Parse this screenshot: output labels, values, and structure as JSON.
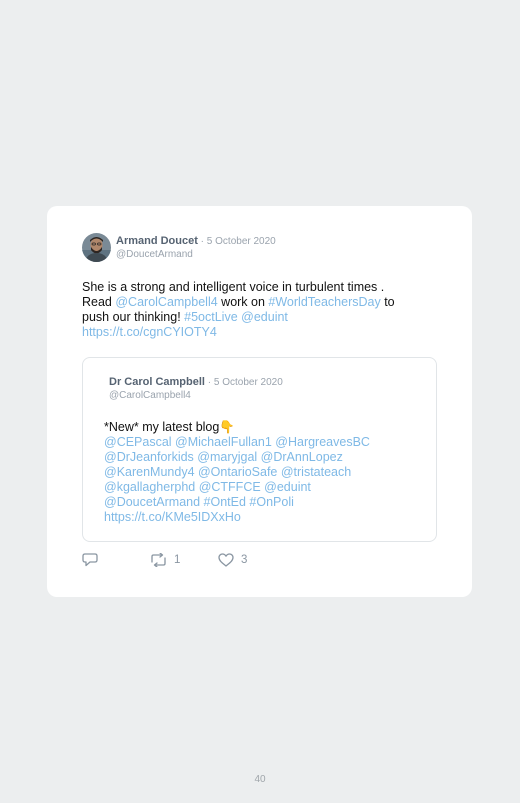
{
  "tweet": {
    "author_name": "Armand Doucet",
    "separator": " · ",
    "date": "5 October 2020",
    "handle": "@DoucetArmand",
    "line1": "She is a strong and intelligent voice in turbulent times .",
    "line2_prefix": "Read ",
    "mention_carol": "@CarolCampbell4",
    "line2_mid": " work on ",
    "hashtag_wtd": "#WorldTeachersDay",
    "line2_suffix": " to",
    "line3_prefix": "push our thinking! ",
    "hashtag_5oct": "#5octLive",
    "mention_eduint": "@eduint",
    "link": "https://t.co/cgnCYIOTY4"
  },
  "quoted_tweet": {
    "author_name": "Dr Carol Campbell",
    "separator": " · ",
    "date": "5 October 2020",
    "handle": "@CarolCampbell4",
    "line1": "*New* my latest blog",
    "emoji": "👇",
    "line2": "@CEPascal @MichaelFullan1 @HargreavesBC",
    "line3": "@DrJeanforkids @maryjgal @DrAnnLopez",
    "line4": "@KarenMundy4 @OntarioSafe @tristateach",
    "line5": "@kgallagherphd @CTFFCE @eduint",
    "line6": "@DoucetArmand #OntEd #OnPoli",
    "link": "https://t.co/KMe5IDXxHo"
  },
  "actions": {
    "reply_icon": "reply-icon",
    "retweet_icon": "retweet-icon",
    "like_icon": "heart-icon",
    "retweet_count": "1",
    "like_count": "3"
  },
  "page": {
    "number": "40"
  },
  "colors": {
    "link": "#7fb9e6",
    "author_name": "#566372",
    "meta": "#9aa3ad",
    "background": "#eceeef",
    "card": "#ffffff"
  }
}
